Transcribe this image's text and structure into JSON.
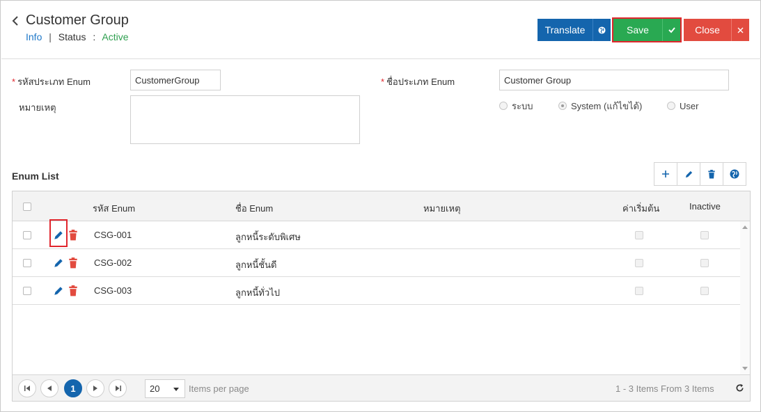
{
  "header": {
    "title": "Customer Group",
    "info_link": "Info",
    "separator": "|",
    "status_label": "Status",
    "status_colon": ":",
    "status_value": "Active",
    "translate_label": "Translate",
    "save_label": "Save",
    "close_label": "Close",
    "colors": {
      "primary": "#1465ad",
      "success": "#29a952",
      "danger": "#e24b3f"
    }
  },
  "form": {
    "enum_code_label": "รหัสประเภท Enum",
    "enum_code_value": "CustomerGroup",
    "enum_name_label": "ชื่อประเภท Enum",
    "enum_name_value": "Customer Group",
    "remark_label": "หมายเหตุ",
    "remark_value": "",
    "required_mark": "*",
    "radio_options": [
      {
        "label": "ระบบ",
        "checked": false
      },
      {
        "label": "System (แก้ไขได้)",
        "checked": true
      },
      {
        "label": "User",
        "checked": false
      }
    ]
  },
  "enum_list": {
    "title": "Enum List",
    "toolbar_icons": [
      "plus-icon",
      "pencil-icon",
      "trash-icon",
      "globe-icon"
    ],
    "columns": [
      "รหัส Enum",
      "ชื่อ Enum",
      "หมายเหตุ",
      "ค่าเริ่มต้น",
      "Inactive"
    ],
    "rows": [
      {
        "code": "CSG-001",
        "name": "ลูกหนี้ระดับพิเศษ",
        "remark": ""
      },
      {
        "code": "CSG-002",
        "name": "ลูกหนี้ชั้นดี",
        "remark": ""
      },
      {
        "code": "CSG-003",
        "name": "ลูกหนี้ทั่วไป",
        "remark": ""
      }
    ]
  },
  "pager": {
    "current_page": "1",
    "page_size": "20",
    "items_per_page_label": "Items per page",
    "summary": "1 - 3 Items From 3 Items"
  }
}
